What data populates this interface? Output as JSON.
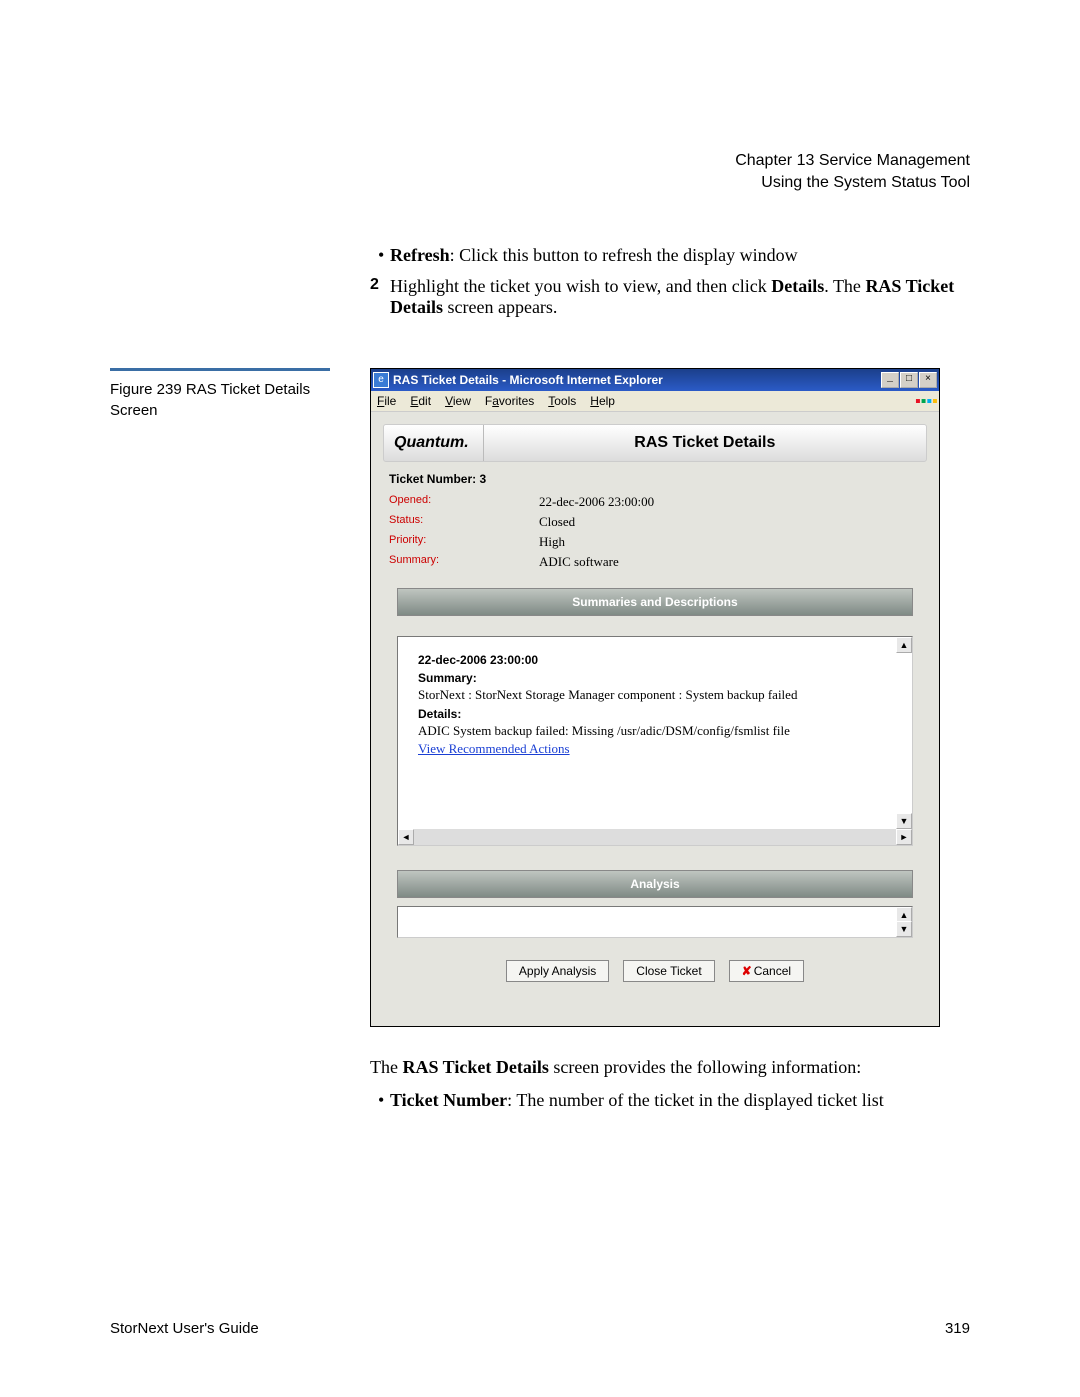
{
  "header": {
    "line1": "Chapter 13  Service Management",
    "line2": "Using the System Status Tool"
  },
  "bullet1": {
    "label": "Refresh",
    "text": ": Click this button to refresh the display window"
  },
  "step2": {
    "num": "2",
    "text_a": "Highlight the ticket you wish to view, and then click ",
    "bold_a": "Details",
    "text_b": ". The ",
    "bold_b": "RAS Ticket Details",
    "text_c": " screen appears."
  },
  "figure_caption": "Figure 239  RAS Ticket Details Screen",
  "window": {
    "title": "RAS Ticket Details - Microsoft Internet Explorer",
    "menus": [
      "File",
      "Edit",
      "View",
      "Favorites",
      "Tools",
      "Help"
    ],
    "brand": "Quantum.",
    "page_title": "RAS Ticket Details",
    "ticket_number_label": "Ticket Number: 3",
    "rows": [
      {
        "label": "Opened:",
        "value": "22-dec-2006 23:00:00"
      },
      {
        "label": "Status:",
        "value": "Closed"
      },
      {
        "label": "Priority:",
        "value": "High"
      },
      {
        "label": "Summary:",
        "value": "ADIC software"
      }
    ],
    "summaries_header": "Summaries and Descriptions",
    "event": {
      "timestamp": "22-dec-2006 23:00:00",
      "summary_label": "Summary:",
      "summary_text": "StorNext : StorNext Storage Manager component : System backup failed",
      "details_label": "Details:",
      "details_text": "ADIC System backup failed: Missing /usr/adic/DSM/config/fsmlist file",
      "link": "View Recommended Actions"
    },
    "analysis_header": "Analysis",
    "buttons": {
      "apply": "Apply Analysis",
      "close": "Close Ticket",
      "cancel": "Cancel"
    }
  },
  "after": {
    "intro_a": "The ",
    "intro_bold": "RAS Ticket Details",
    "intro_b": " screen provides the following information:",
    "bullet_label": "Ticket Number",
    "bullet_text": ": The number of the ticket in the displayed ticket list"
  },
  "footer": {
    "left": "StorNext User's Guide",
    "right": "319"
  }
}
